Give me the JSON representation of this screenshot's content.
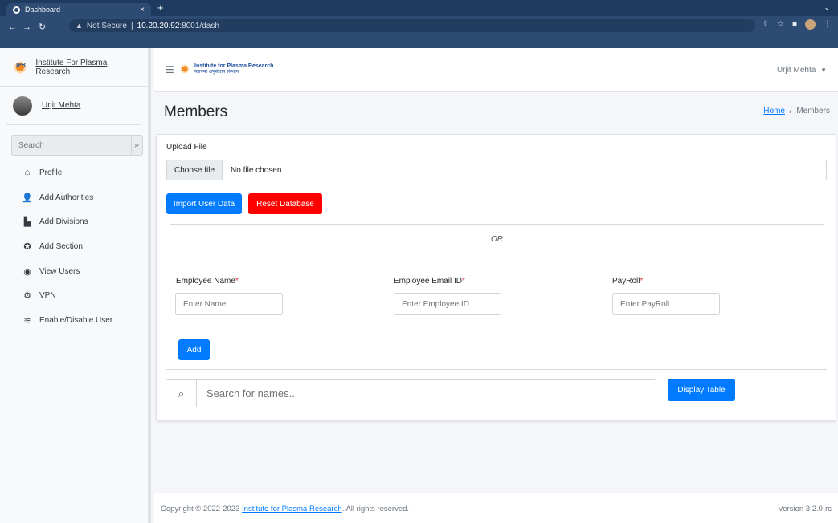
{
  "browser": {
    "tab_title": "Dashboard",
    "tab_close": "×",
    "new_tab": "+",
    "dropdown": "⌄",
    "url_warning": "Not Secure",
    "url_separator": "|",
    "url_host": "10.20.20.92",
    "url_rest": ":8001/dash"
  },
  "sidebar": {
    "brand": "Institute For Plasma Research",
    "user": "Urjit Mehta",
    "search_placeholder": "Search",
    "items": [
      {
        "label": "Profile",
        "icon": "home-icon",
        "glyph": "⌂"
      },
      {
        "label": "Add Authorities",
        "icon": "user-plus-icon",
        "glyph": "👤"
      },
      {
        "label": "Add Divisions",
        "icon": "door-icon",
        "glyph": "▙"
      },
      {
        "label": "Add Section",
        "icon": "life-ring-icon",
        "glyph": "✪"
      },
      {
        "label": "View Users",
        "icon": "eye-icon",
        "glyph": "◉"
      },
      {
        "label": "VPN",
        "icon": "cogs-icon",
        "glyph": "⚙"
      },
      {
        "label": "Enable/Disable User",
        "icon": "eye-slash-icon",
        "glyph": "≋"
      }
    ]
  },
  "topbar": {
    "logo_line1": "Institute for Plasma Research",
    "logo_line2": "प्लाज़्मा अनुसंधान संस्थान",
    "user": "Urjit Mehta"
  },
  "content": {
    "title": "Members",
    "breadcrumb_home": "Home",
    "breadcrumb_sep": "/",
    "breadcrumb_current": "Members",
    "upload_label": "Upload File",
    "choose_file": "Choose file",
    "no_file": "No file chosen",
    "import_button": "Import User Data",
    "reset_button": "Reset Database",
    "or_text": "OR",
    "fields": [
      {
        "label": "Employee Name",
        "placeholder": "Enter Name"
      },
      {
        "label": "Employee Email ID",
        "placeholder": "Enter Employee ID"
      },
      {
        "label": "PayRoll",
        "placeholder": "Enter PayRoll"
      }
    ],
    "required_mark": "*",
    "add_button": "Add",
    "search_placeholder": "Search for names..",
    "display_button": "Display Table"
  },
  "footer": {
    "copyright_prefix": "Copyright © 2022-2023",
    "org_link": "Institute for Plasma Research",
    "copyright_suffix": ". All rights reserved.",
    "version": "Version 3.2.0-rc"
  },
  "colors": {
    "primary": "#007bff",
    "danger": "#ff0000",
    "chrome": "#2d4b73"
  }
}
